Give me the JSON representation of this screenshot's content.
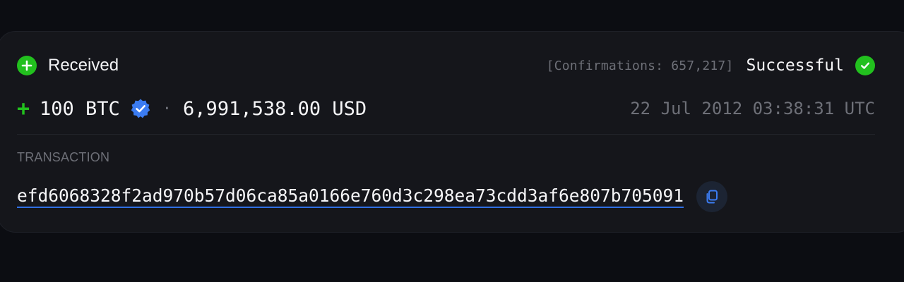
{
  "transaction": {
    "direction_label": "Received",
    "confirmations_text": "[Confirmations: 657,217]",
    "status_label": "Successful",
    "amount_sign": "+",
    "amount": "100 BTC",
    "separator": "·",
    "usd_value": "6,991,538.00 USD",
    "timestamp": "22 Jul 2012 03:38:31 UTC",
    "section_label": "TRANSACTION",
    "hash": "efd6068328f2ad970b57d06ca85a0166e760d3c298ea73cdd3af6e807b705091"
  },
  "icons": {
    "received": "plus-circle-icon",
    "status": "check-circle-icon",
    "verified": "verified-badge-icon",
    "copy": "copy-icon"
  },
  "colors": {
    "background": "#0c0d12",
    "card": "#15161b",
    "success_green": "#22c01e",
    "link_blue": "#2f6fe4",
    "verified_blue": "#3b7cf2",
    "muted_text": "#6e7078"
  }
}
